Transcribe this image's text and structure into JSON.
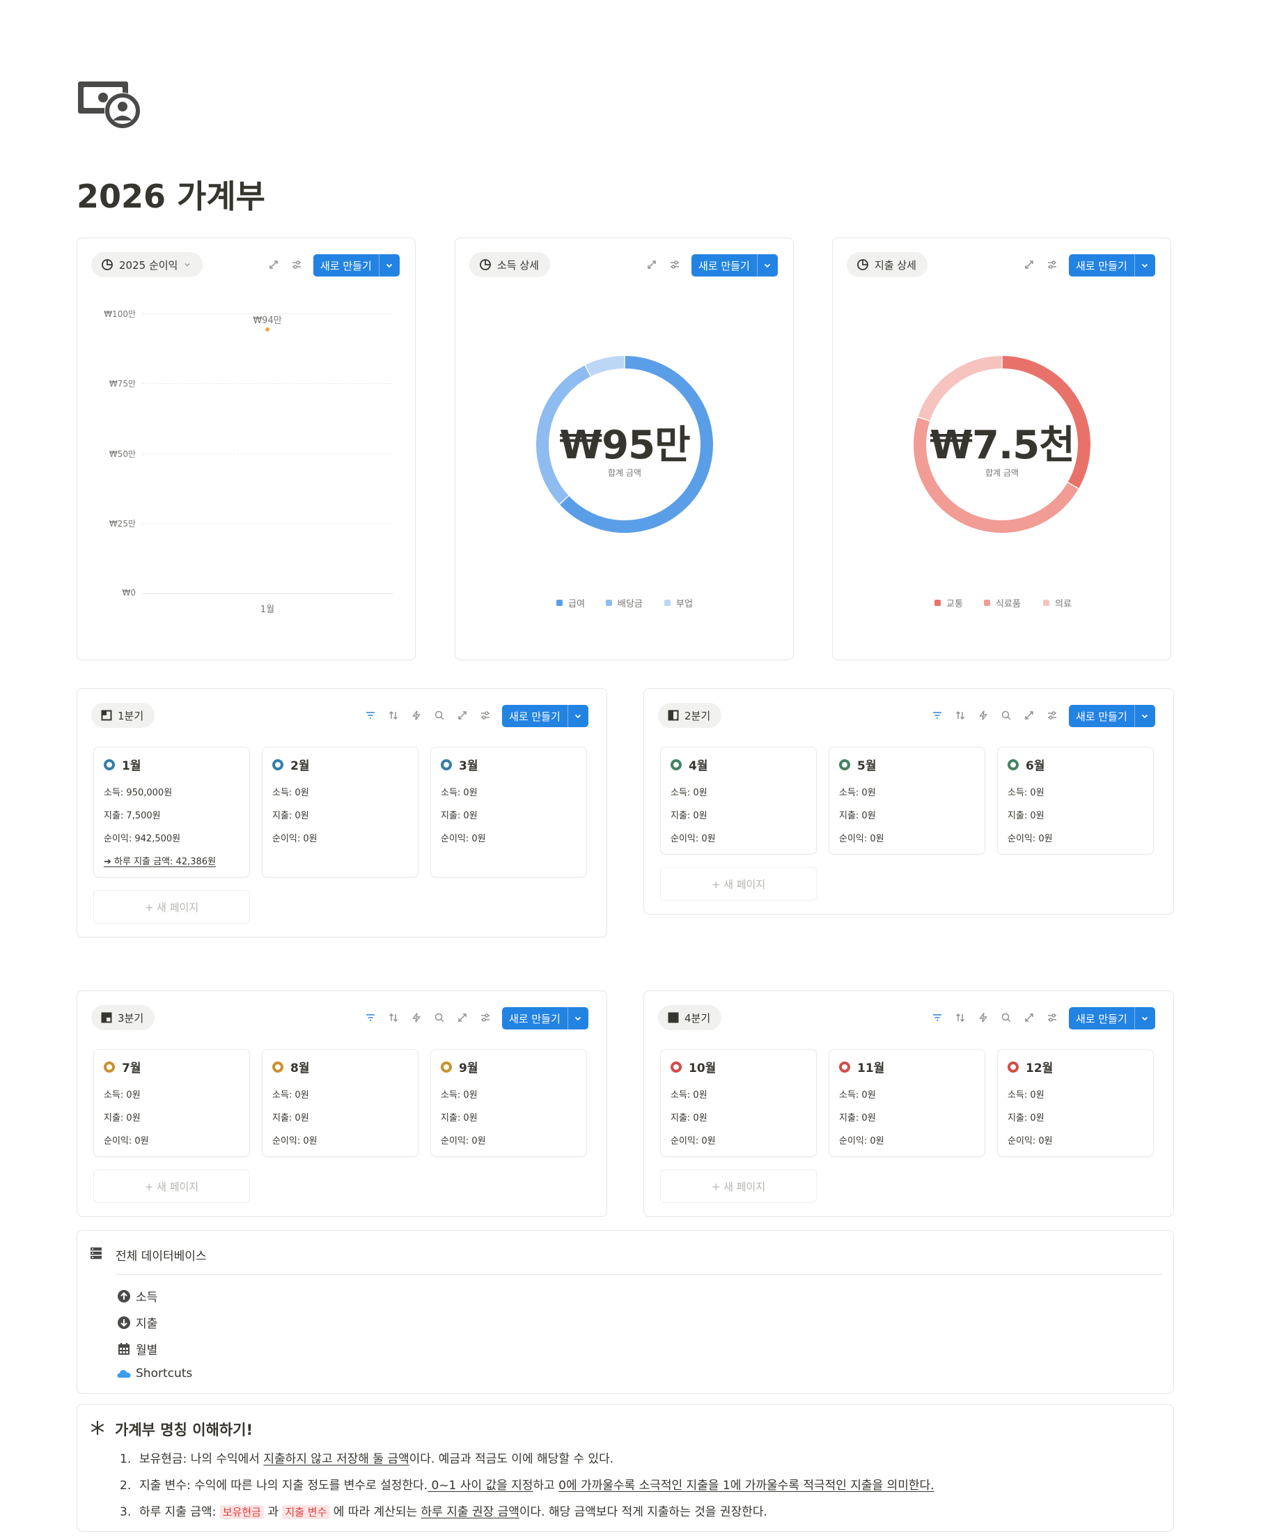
{
  "page": {
    "title": "2026 가계부"
  },
  "charts": {
    "profit": {
      "label": "2025 순이익",
      "new_btn": "새로 만들기"
    },
    "income": {
      "label": "소득 상세",
      "new_btn": "새로 만들기",
      "center_value": "₩95만",
      "center_label": "합계 금액",
      "legend": [
        "급여",
        "배당금",
        "부업"
      ]
    },
    "expense": {
      "label": "지출 상세",
      "new_btn": "새로 만들기",
      "center_value": "₩7.5천",
      "center_label": "합계 금액",
      "legend": [
        "교통",
        "식료품",
        "의료"
      ]
    }
  },
  "chart_data": [
    {
      "type": "line",
      "title": "2025 순이익",
      "categories": [
        "1월"
      ],
      "values": [
        942500
      ],
      "data_labels": [
        "₩94만"
      ],
      "ylim": [
        0,
        1000000
      ],
      "yticks": [
        "₩0",
        "₩25만",
        "₩50만",
        "₩75만",
        "₩100만"
      ],
      "grid": true
    },
    {
      "type": "pie",
      "title": "소득 상세",
      "labels": [
        "급여",
        "배당금",
        "부업"
      ],
      "values": [
        600000,
        280000,
        70000
      ],
      "colors": [
        "#5b9ee8",
        "#8fbcf0",
        "#bcd6f6"
      ],
      "total": "₩95만"
    },
    {
      "type": "pie",
      "title": "지출 상세",
      "labels": [
        "교통",
        "식료품",
        "의료"
      ],
      "values": [
        2500,
        3500,
        1500
      ],
      "colors": [
        "#e8726a",
        "#f19c95",
        "#f6c3be"
      ],
      "total": "₩7.5천"
    }
  ],
  "boards": {
    "q1": {
      "label": "1분기",
      "new_btn": "새로 만들기",
      "new_page": "+ 새 페이지",
      "cards": [
        {
          "title": "1월",
          "lines": [
            "소득: 950,000원",
            "지출: 7,500원",
            "순이익: 942,500원"
          ],
          "extra": "➔ 하루 지출 금액: 42,386원"
        },
        {
          "title": "2월",
          "lines": [
            "소득: 0원",
            "지출: 0원",
            "순이익: 0원"
          ]
        },
        {
          "title": "3월",
          "lines": [
            "소득: 0원",
            "지출: 0원",
            "순이익: 0원"
          ]
        }
      ]
    },
    "q2": {
      "label": "2분기",
      "new_btn": "새로 만들기",
      "new_page": "+ 새 페이지",
      "cards": [
        {
          "title": "4월",
          "lines": [
            "소득: 0원",
            "지출: 0원",
            "순이익: 0원"
          ]
        },
        {
          "title": "5월",
          "lines": [
            "소득: 0원",
            "지출: 0원",
            "순이익: 0원"
          ]
        },
        {
          "title": "6월",
          "lines": [
            "소득: 0원",
            "지출: 0원",
            "순이익: 0원"
          ]
        }
      ]
    },
    "q3": {
      "label": "3분기",
      "new_btn": "새로 만들기",
      "new_page": "+ 새 페이지",
      "cards": [
        {
          "title": "7월",
          "lines": [
            "소득: 0원",
            "지출: 0원",
            "순이익: 0원"
          ]
        },
        {
          "title": "8월",
          "lines": [
            "소득: 0원",
            "지출: 0원",
            "순이익: 0원"
          ]
        },
        {
          "title": "9월",
          "lines": [
            "소득: 0원",
            "지출: 0원",
            "순이익: 0원"
          ]
        }
      ]
    },
    "q4": {
      "label": "4분기",
      "new_btn": "새로 만들기",
      "new_page": "+ 새 페이지",
      "cards": [
        {
          "title": "10월",
          "lines": [
            "소득: 0원",
            "지출: 0원",
            "순이익: 0원"
          ]
        },
        {
          "title": "11월",
          "lines": [
            "소득: 0원",
            "지출: 0원",
            "순이익: 0원"
          ]
        },
        {
          "title": "12월",
          "lines": [
            "소득: 0원",
            "지출: 0원",
            "순이익: 0원"
          ]
        }
      ]
    }
  },
  "database": {
    "title": "전체 데이터베이스",
    "items": [
      "소득",
      "지출",
      "월별",
      "Shortcuts"
    ]
  },
  "callout": {
    "title": "가계부 명칭 이해하기!",
    "items": [
      {
        "num": "1.",
        "a": "보유현금: 나의 수익에서 ",
        "b": "지출하지 않고 저장해 둘 금액",
        "c": "이다. 예금과 적금도 이에 해당할 수 있다."
      },
      {
        "num": "2.",
        "a": "지출 변수: 수익에 따른 나의 지출 정도를 변수로 설정한다.",
        "b": " 0~1 사이 값을 지정",
        "c": "하고 ",
        "d": "0에 가까울수록 소극적인 지출을 1에 가까울수록 적극적인 지출을 의미한다."
      },
      {
        "num": "3.",
        "a": "하루 지출 금액: ",
        "tag1": "보유현금",
        "b": " 과 ",
        "tag2": "지출  변수",
        "c": " 에 따라 계산되는 ",
        "d": "하루 지출 권장 금액",
        "e": "이다. 해당 금액보다 적게 지출하는 것을 권장한다."
      }
    ]
  },
  "colors": {
    "accent": "#2383e2",
    "q1": "#337ea9",
    "q2": "#448361",
    "q3": "#cb912f",
    "q4": "#d44c47",
    "point": "#f0a64a"
  }
}
